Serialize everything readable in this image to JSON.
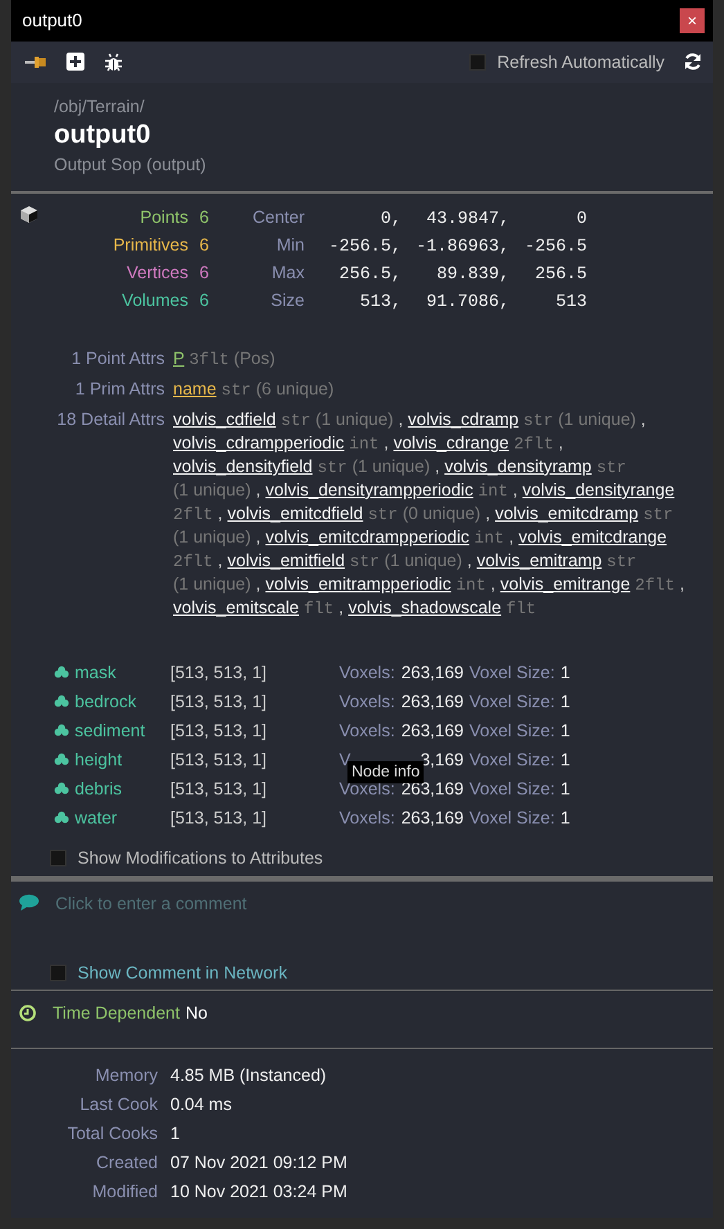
{
  "window": {
    "title": "output0",
    "close": "×"
  },
  "toolbar": {
    "refresh": {
      "label": "Refresh Automatically",
      "checked": false
    }
  },
  "header": {
    "path": "/obj/Terrain/",
    "name": "output0",
    "type": "Output Sop (output)"
  },
  "counts": [
    {
      "label": "Points",
      "value": "6",
      "color": "#8fc46a"
    },
    {
      "label": "Primitives",
      "value": "6",
      "color": "#e8b84a"
    },
    {
      "label": "Vertices",
      "value": "6",
      "color": "#d07ac0"
    },
    {
      "label": "Volumes",
      "value": "6",
      "color": "#4cc4a0"
    }
  ],
  "bounds": [
    {
      "label": "Center",
      "values": [
        "0,",
        "43.9847,",
        "0"
      ]
    },
    {
      "label": "Min",
      "values": [
        "-256.5,",
        "-1.86963,",
        "-256.5"
      ]
    },
    {
      "label": "Max",
      "values": [
        "256.5,",
        "89.839,",
        "256.5"
      ]
    },
    {
      "label": "Size",
      "values": [
        "513,",
        "91.7086,",
        "513"
      ]
    }
  ],
  "attributes": [
    {
      "label": "1 Point Attrs",
      "items": [
        {
          "name": "P",
          "color": "#8fc46a",
          "type": "3flt",
          "info": "(Pos)"
        }
      ]
    },
    {
      "label": "1 Prim Attrs",
      "items": [
        {
          "name": "name",
          "color": "#e8b84a",
          "type": "str",
          "info": "(6 unique)"
        }
      ]
    },
    {
      "label": "18 Detail Attrs",
      "separator": ",",
      "items": [
        {
          "name": "volvis_cdfield",
          "color": "#f2f2f2",
          "type": "str",
          "info": "(1 unique)"
        },
        {
          "name": "volvis_cdramp",
          "color": "#f2f2f2",
          "type": "str",
          "info": "(1 unique)"
        },
        {
          "name": "volvis_cdrampperiodic",
          "color": "#f2f2f2",
          "type": "int"
        },
        {
          "name": "volvis_cdrange",
          "color": "#f2f2f2",
          "type": "2flt"
        },
        {
          "name": "volvis_densityfield",
          "color": "#f2f2f2",
          "type": "str",
          "info": "(1 unique)"
        },
        {
          "name": "volvis_densityramp",
          "color": "#f2f2f2",
          "type": "str",
          "info": "(1 unique)"
        },
        {
          "name": "volvis_densityrampperiodic",
          "color": "#f2f2f2",
          "type": "int"
        },
        {
          "name": "volvis_densityrange",
          "color": "#f2f2f2",
          "type": "2flt"
        },
        {
          "name": "volvis_emitcdfield",
          "color": "#f2f2f2",
          "type": "str",
          "info": "(0 unique)"
        },
        {
          "name": "volvis_emitcdramp",
          "color": "#f2f2f2",
          "type": "str",
          "info": "(1 unique)"
        },
        {
          "name": "volvis_emitcdrampperiodic",
          "color": "#f2f2f2",
          "type": "int"
        },
        {
          "name": "volvis_emitcdrange",
          "color": "#f2f2f2",
          "type": "2flt"
        },
        {
          "name": "volvis_emitfield",
          "color": "#f2f2f2",
          "type": "str",
          "info": "(1 unique)"
        },
        {
          "name": "volvis_emitramp",
          "color": "#f2f2f2",
          "type": "str",
          "info": "(1 unique)"
        },
        {
          "name": "volvis_emitrampperiodic",
          "color": "#f2f2f2",
          "type": "int"
        },
        {
          "name": "volvis_emitrange",
          "color": "#f2f2f2",
          "type": "2flt"
        },
        {
          "name": "volvis_emitscale",
          "color": "#f2f2f2",
          "type": "flt"
        },
        {
          "name": "volvis_shadowscale",
          "color": "#f2f2f2",
          "type": "flt"
        }
      ]
    }
  ],
  "volumes": [
    {
      "name": "mask",
      "resolution": "[513, 513, 1]",
      "voxels_label": "Voxels:",
      "voxels": "263,169",
      "size_label": "Voxel Size:",
      "size": "1"
    },
    {
      "name": "bedrock",
      "resolution": "[513, 513, 1]",
      "voxels_label": "Voxels:",
      "voxels": "263,169",
      "size_label": "Voxel Size:",
      "size": "1"
    },
    {
      "name": "sediment",
      "resolution": "[513, 513, 1]",
      "voxels_label": "Voxels:",
      "voxels": "263,169",
      "size_label": "Voxel Size:",
      "size": "1"
    },
    {
      "name": "height",
      "resolution": "[513, 513, 1]",
      "voxels_label": "V",
      "voxels": "3,169",
      "size_label": "Voxel Size:",
      "size": "1"
    },
    {
      "name": "debris",
      "resolution": "[513, 513, 1]",
      "voxels_label": "Voxels:",
      "voxels": "263,169",
      "size_label": "Voxel Size:",
      "size": "1"
    },
    {
      "name": "water",
      "resolution": "[513, 513, 1]",
      "voxels_label": "Voxels:",
      "voxels": "263,169",
      "size_label": "Voxel Size:",
      "size": "1"
    }
  ],
  "tooltip": "Node info",
  "show_modifications": {
    "label": "Show Modifications to Attributes",
    "checked": false
  },
  "comment": {
    "placeholder": "Click to enter a comment"
  },
  "show_comment": {
    "label": "Show Comment in Network",
    "checked": false
  },
  "time_dependent": {
    "label": "Time Dependent",
    "value": "No"
  },
  "info": [
    {
      "label": "Memory",
      "value": "4.85 MB (Instanced)"
    },
    {
      "label": "Last Cook",
      "value": "0.04 ms"
    },
    {
      "label": "Total Cooks",
      "value": "1"
    },
    {
      "label": "Created",
      "value": "07 Nov 2021 09:12 PM"
    },
    {
      "label": "Modified",
      "value": "10 Nov 2021 03:24 PM"
    }
  ]
}
